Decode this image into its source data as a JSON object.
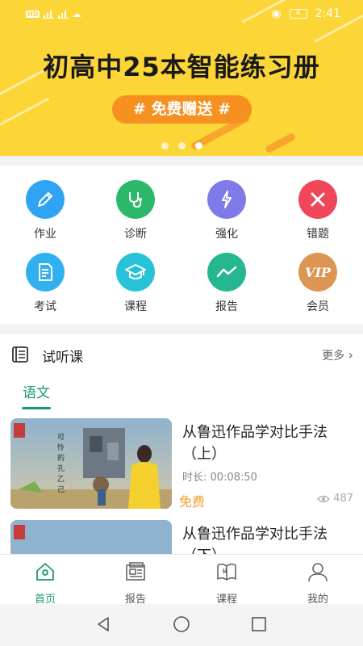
{
  "status_bar": {
    "time": "2:41",
    "carrier_badge": "HD",
    "battery_level": "4"
  },
  "banner": {
    "title": "初高中25本智能练习册",
    "pill": "# 免费赠送 #",
    "slide_count": 3,
    "active_slide": 3,
    "colors": {
      "background": "#fcd537",
      "pill": "#f6901f"
    }
  },
  "features": [
    {
      "label": "作业",
      "icon": "pencil-icon",
      "color": "#2fa4f5"
    },
    {
      "label": "诊断",
      "icon": "stethoscope-icon",
      "color": "#2cb86b"
    },
    {
      "label": "强化",
      "icon": "lightning-icon",
      "color": "#7e7be8"
    },
    {
      "label": "错题",
      "icon": "cross-icon",
      "color": "#f0465a"
    },
    {
      "label": "考试",
      "icon": "document-icon",
      "color": "#31b0f0"
    },
    {
      "label": "课程",
      "icon": "graduation-cap-icon",
      "color": "#27c2d8"
    },
    {
      "label": "报告",
      "icon": "trend-line-icon",
      "color": "#25b78f"
    },
    {
      "label": "会员",
      "icon": "vip-icon",
      "color": "#dc9552",
      "text": "VIP"
    }
  ],
  "trial": {
    "title": "试听课",
    "more": "更多",
    "tab": "语文",
    "courses": [
      {
        "title": "从鲁迅作品学对比手法（上）",
        "duration": "时长: 00:08:50",
        "price": "免费",
        "views": "487",
        "thumb_caption": "可怜的孔乙己"
      },
      {
        "title": "从鲁迅作品学对比手法（下）"
      }
    ]
  },
  "bottom_nav": [
    {
      "label": "首页",
      "icon": "home-icon",
      "active": true
    },
    {
      "label": "报告",
      "icon": "report-icon",
      "active": false
    },
    {
      "label": "课程",
      "icon": "book-icon",
      "active": false
    },
    {
      "label": "我的",
      "icon": "user-icon",
      "active": false
    }
  ],
  "accent_color": "#1a9a6c"
}
